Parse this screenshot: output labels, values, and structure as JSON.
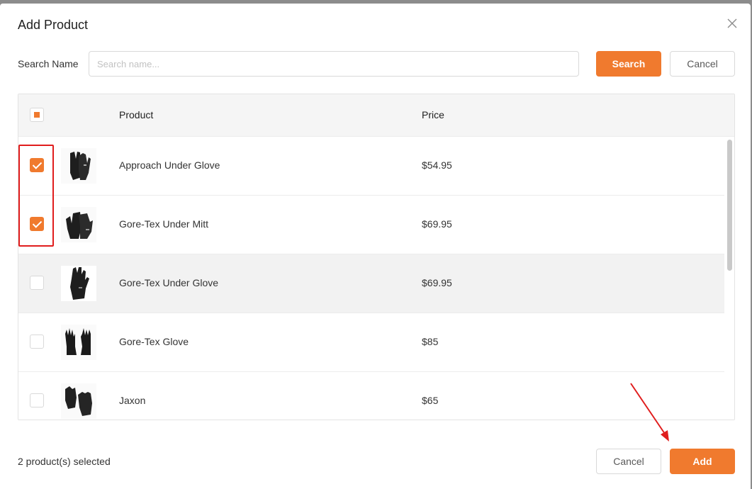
{
  "modal": {
    "title": "Add Product"
  },
  "search": {
    "label": "Search Name",
    "placeholder": "Search name...",
    "value": "",
    "search_button": "Search",
    "cancel_button": "Cancel"
  },
  "table": {
    "columns": [
      "Product",
      "Price"
    ],
    "rows": [
      {
        "name": "Approach Under Glove",
        "price": "$54.95",
        "checked": true
      },
      {
        "name": "Gore-Tex Under Mitt",
        "price": "$69.95",
        "checked": true
      },
      {
        "name": "Gore-Tex Under Glove",
        "price": "$69.95",
        "checked": false
      },
      {
        "name": "Gore-Tex Glove",
        "price": "$85",
        "checked": false
      },
      {
        "name": "Jaxon",
        "price": "$65",
        "checked": false
      }
    ]
  },
  "footer": {
    "status": "2 product(s) selected",
    "cancel_button": "Cancel",
    "add_button": "Add"
  },
  "colors": {
    "accent": "#f07a2e",
    "annotation": "#e01d1d"
  },
  "icons": [
    "close-icon",
    "check-icon",
    "glove-image",
    "mitt-image",
    "pair-gloves-image"
  ]
}
